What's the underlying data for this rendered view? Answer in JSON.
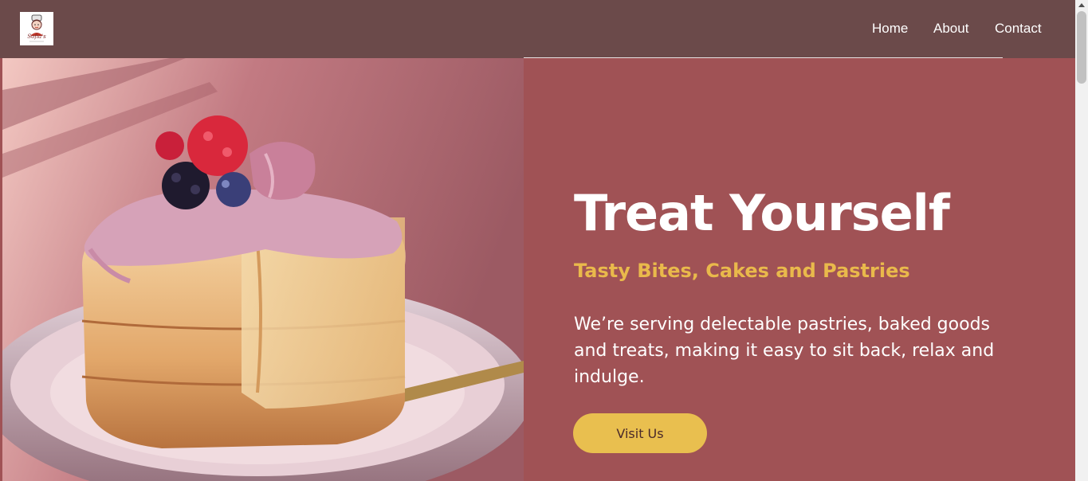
{
  "brand": {
    "logo_icon": "baker-logo-icon",
    "logo_text": "Sofia's"
  },
  "nav": {
    "items": [
      {
        "label": "Home"
      },
      {
        "label": "About"
      },
      {
        "label": "Contact"
      }
    ]
  },
  "hero": {
    "image_icon": "cake-icon",
    "title": "Treat Yourself",
    "subtitle": "Tasty Bites, Cakes and Pastries",
    "description": "We’re serving delectable pastries, baked goods and treats, making it easy to sit back, relax and indulge.",
    "button_label": "Visit Us"
  },
  "colors": {
    "nav_background": "#6b4a4a",
    "hero_background": "#a05255",
    "accent": "#e9b94b",
    "button": "#e9bf4f"
  }
}
